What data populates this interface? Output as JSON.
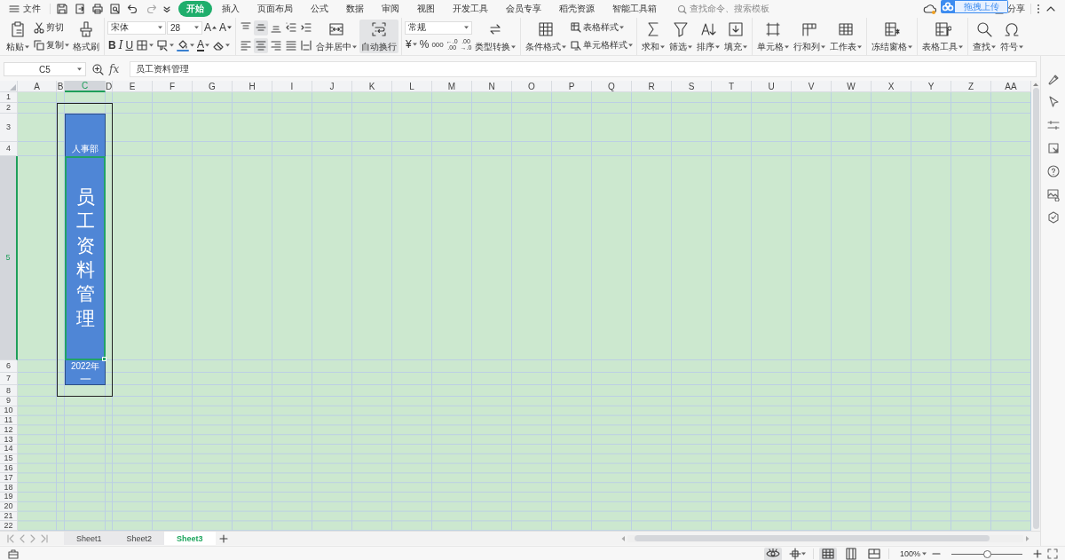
{
  "menu": {
    "file": "文件",
    "tabs": [
      {
        "label": "开始",
        "selected": true
      },
      {
        "label": "插入",
        "selected": false
      },
      {
        "label": "页面布局",
        "selected": false
      },
      {
        "label": "公式",
        "selected": false
      },
      {
        "label": "数据",
        "selected": false
      },
      {
        "label": "审阅",
        "selected": false
      },
      {
        "label": "视图",
        "selected": false
      },
      {
        "label": "开发工具",
        "selected": false
      },
      {
        "label": "会员专享",
        "selected": false
      },
      {
        "label": "稻壳资源",
        "selected": false
      },
      {
        "label": "智能工具箱",
        "selected": false
      }
    ],
    "search": {
      "placeholder": "查找命令、搜索模板"
    },
    "share": "分享"
  },
  "upload_tip": "拖拽上传",
  "ribbon": {
    "clipboard": {
      "paste": "粘贴",
      "cut": "剪切",
      "copy": "复制",
      "format_painter": "格式刷"
    },
    "font": {
      "name": "宋体",
      "size": "28",
      "grow": "A",
      "shrink": "A",
      "bold": "B",
      "italic": "I",
      "underline": "U",
      "font_color": "A"
    },
    "alignment": {
      "buttons": [
        {
          "selected": false
        },
        {
          "selected": true
        },
        {
          "selected": false
        },
        {
          "selected": false
        },
        {
          "selected": false
        },
        {
          "selected": false
        },
        {
          "selected": true
        },
        {
          "selected": false
        },
        {
          "selected": false
        },
        {
          "selected": false
        }
      ],
      "merge": "合并居中",
      "wrap": {
        "label": "自动换行",
        "selected": true
      }
    },
    "number": {
      "format": "常规",
      "currency": "¥",
      "percent": "%",
      "thousands": "000",
      "increase_decimal": [
        "←.0",
        ".00"
      ],
      "decrease_decimal": [
        ".00",
        "→.0"
      ],
      "convert": "类型转换"
    },
    "styles": {
      "conditional": "条件格式",
      "table_style": "表格样式",
      "cell_style": "单元格样式"
    },
    "tools": [
      {
        "label": "求和"
      },
      {
        "label": "筛选"
      },
      {
        "label": "排序"
      },
      {
        "label": "填充"
      },
      {
        "label": "单元格"
      },
      {
        "label": "行和列"
      },
      {
        "label": "工作表"
      },
      {
        "label": "冻结窗格"
      },
      {
        "label": "表格工具"
      },
      {
        "label": "查找"
      },
      {
        "label": "符号"
      }
    ]
  },
  "formula_bar": {
    "name_box": "C5",
    "fx": "fx",
    "content": "员工资料管理"
  },
  "sheet": {
    "columns": [
      {
        "label": "A",
        "selected": false
      },
      {
        "label": "B",
        "selected": false
      },
      {
        "label": "C",
        "selected": true
      },
      {
        "label": "D",
        "selected": false
      },
      {
        "label": "E",
        "selected": false
      },
      {
        "label": "F",
        "selected": false
      },
      {
        "label": "G",
        "selected": false
      },
      {
        "label": "H",
        "selected": false
      },
      {
        "label": "I",
        "selected": false
      },
      {
        "label": "J",
        "selected": false
      },
      {
        "label": "K",
        "selected": false
      },
      {
        "label": "L",
        "selected": false
      },
      {
        "label": "M",
        "selected": false
      },
      {
        "label": "N",
        "selected": false
      },
      {
        "label": "O",
        "selected": false
      },
      {
        "label": "P",
        "selected": false
      },
      {
        "label": "Q",
        "selected": false
      },
      {
        "label": "R",
        "selected": false
      },
      {
        "label": "S",
        "selected": false
      },
      {
        "label": "T",
        "selected": false
      },
      {
        "label": "U",
        "selected": false
      },
      {
        "label": "V",
        "selected": false
      },
      {
        "label": "W",
        "selected": false
      },
      {
        "label": "X",
        "selected": false
      },
      {
        "label": "Y",
        "selected": false
      },
      {
        "label": "Z",
        "selected": false
      },
      {
        "label": "AA",
        "selected": false
      }
    ],
    "rows": [
      {
        "label": "1",
        "selected": false
      },
      {
        "label": "2",
        "selected": false
      },
      {
        "label": "3",
        "selected": false
      },
      {
        "label": "4",
        "selected": false
      },
      {
        "label": "5",
        "selected": true
      },
      {
        "label": "6",
        "selected": false
      },
      {
        "label": "7",
        "selected": false
      },
      {
        "label": "8",
        "selected": false
      },
      {
        "label": "9",
        "selected": false
      },
      {
        "label": "10",
        "selected": false
      },
      {
        "label": "11",
        "selected": false
      },
      {
        "label": "12",
        "selected": false
      },
      {
        "label": "13",
        "selected": false
      },
      {
        "label": "14",
        "selected": false
      },
      {
        "label": "15",
        "selected": false
      },
      {
        "label": "16",
        "selected": false
      },
      {
        "label": "17",
        "selected": false
      },
      {
        "label": "18",
        "selected": false
      },
      {
        "label": "19",
        "selected": false
      },
      {
        "label": "20",
        "selected": false
      },
      {
        "label": "21",
        "selected": false
      },
      {
        "label": "22",
        "selected": false
      }
    ],
    "cells": {
      "dept": "人事部",
      "title": "员工资料管理",
      "year": "2022年",
      "month": "一"
    }
  },
  "sheet_tabs": [
    {
      "label": "Sheet1",
      "selected": false
    },
    {
      "label": "Sheet2",
      "selected": false
    },
    {
      "label": "Sheet3",
      "selected": true
    }
  ],
  "status_bar": {
    "eye_care": true,
    "views": [
      {
        "selected": true
      },
      {
        "selected": false
      },
      {
        "selected": false
      }
    ],
    "zoom": "100%",
    "zoom_slider": {
      "level": 0.5
    }
  }
}
